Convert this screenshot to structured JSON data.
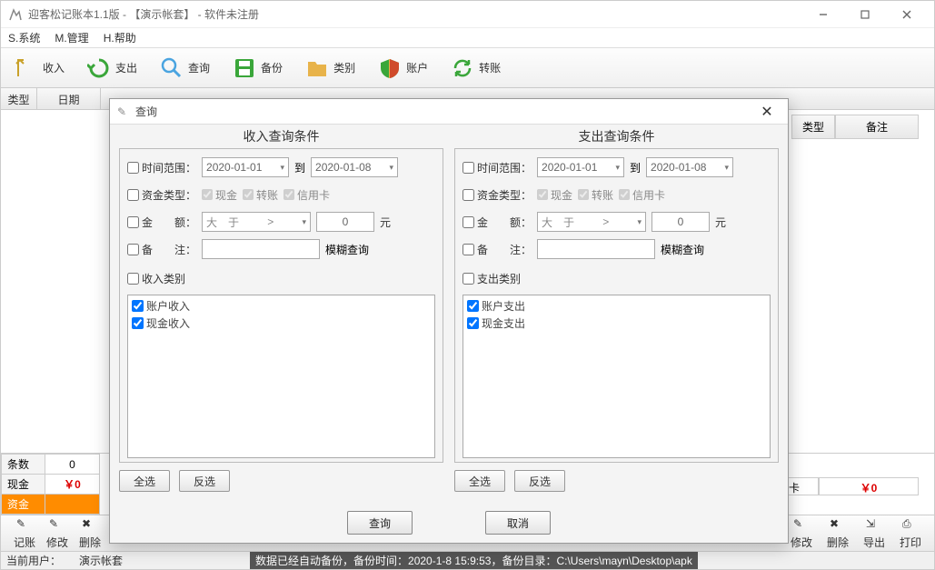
{
  "window": {
    "title": "迎客松记账本1.1版 - 【演示帐套】 - 软件未注册"
  },
  "menubar": {
    "system": "S.系统",
    "manage": "M.管理",
    "help": "H.帮助"
  },
  "toolbar": {
    "income": "收入",
    "expense": "支出",
    "query": "查询",
    "backup": "备份",
    "category": "类别",
    "account": "账户",
    "transfer": "转账"
  },
  "grid": {
    "col_type": "类型",
    "col_date": "日期",
    "col_type2": "类型",
    "col_note": "备注"
  },
  "summary": {
    "row1_label": "条数",
    "row1_val": "0",
    "row2_label": "现金",
    "row2_val": "￥0",
    "row3_label": "资金",
    "card_label": "卡",
    "card_val": "￥0"
  },
  "bottom_toolbar": {
    "record": "记账",
    "edit": "修改",
    "delete": "删除",
    "edit2": "修改",
    "delete2": "删除",
    "export": "导出",
    "print": "打印"
  },
  "statusbar": {
    "user_label": "当前用户：",
    "user_val": "演示帐套",
    "backup_msg": "数据已经自动备份，备份时间：2020-1-8 15:9:53，备份目录：C:\\Users\\mayn\\Desktop\\apk"
  },
  "dialog": {
    "title": "查询",
    "income_panel": {
      "legend": "收入查询条件",
      "time_range": "时间范围：",
      "date_from": "2020-01-01",
      "date_to_label": "到",
      "date_to": "2020-01-08",
      "fund_type": "资金类型：",
      "cash": "现金",
      "transfer": "转账",
      "credit": "信用卡",
      "amount": "金　　额：",
      "op": "大　于",
      "op_caret": ">",
      "amount_val": "0",
      "unit": "元",
      "remark": "备　　注：",
      "fuzzy": "模糊查询",
      "category": "收入类别",
      "cat_items": [
        "账户收入",
        "现金收入"
      ],
      "select_all": "全选",
      "invert": "反选"
    },
    "expense_panel": {
      "legend": "支出查询条件",
      "time_range": "时间范围：",
      "date_from": "2020-01-01",
      "date_to_label": "到",
      "date_to": "2020-01-08",
      "fund_type": "资金类型：",
      "cash": "现金",
      "transfer": "转账",
      "credit": "信用卡",
      "amount": "金　　额：",
      "op": "大　于",
      "op_caret": ">",
      "amount_val": "0",
      "unit": "元",
      "remark": "备　　注：",
      "fuzzy": "模糊查询",
      "category": "支出类别",
      "cat_items": [
        "账户支出",
        "现金支出"
      ],
      "select_all": "全选",
      "invert": "反选"
    },
    "footer": {
      "ok": "查询",
      "cancel": "取消"
    }
  }
}
